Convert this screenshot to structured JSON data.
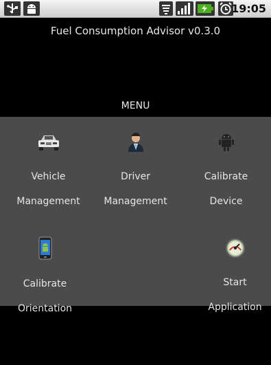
{
  "status_bar": {
    "time": "19:05",
    "icons": [
      "usb-icon",
      "android-notification-icon",
      "wifi-icon",
      "signal-icon",
      "battery-charging-icon",
      "alarm-icon"
    ]
  },
  "app": {
    "title": "Fuel Consumption Advisor v0.3.0",
    "menu_label": "MENU"
  },
  "menu_items": [
    {
      "id": "vehicle",
      "icon": "car-icon",
      "line1": "Vehicle",
      "line2": "Management"
    },
    {
      "id": "driver",
      "icon": "person-icon",
      "line1": "Driver",
      "line2": "Management"
    },
    {
      "id": "calibrate-device",
      "icon": "android-robot-icon",
      "line1": "Calibrate",
      "line2": "Device"
    },
    {
      "id": "calibrate-orientation",
      "icon": "phone-icon",
      "line1": "Calibrate",
      "line2": "Orientation"
    },
    {
      "id": "start-application",
      "icon": "speedometer-icon",
      "line1": "Start",
      "line2": "Application"
    }
  ],
  "colors": {
    "panel_bg": "#4b4b4b",
    "screen_bg": "#000000",
    "status_bg": "#e0e0e0"
  }
}
